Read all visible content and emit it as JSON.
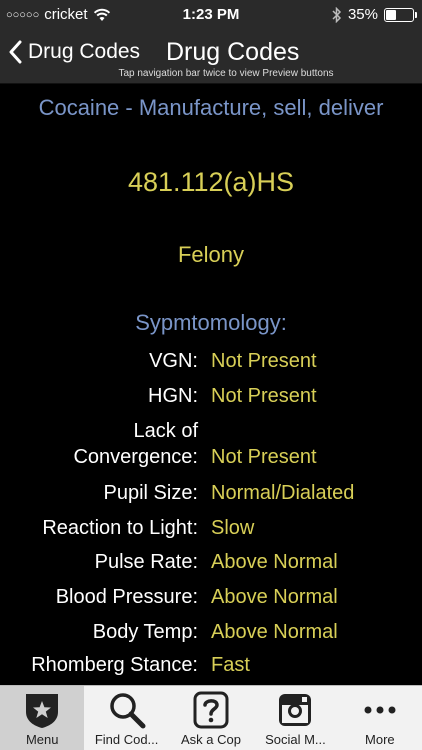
{
  "status_bar": {
    "carrier": "cricket",
    "signal_dots": "○○○○○",
    "time": "1:23 PM",
    "battery_percent": "35%",
    "battery_level": 0.35
  },
  "nav": {
    "back_label": "Drug Codes",
    "title": "Drug Codes",
    "hint": "Tap navigation bar twice to view Preview buttons"
  },
  "drug": {
    "name": "Cocaine - Manufacture, sell, deliver",
    "code": "481.112(a)HS",
    "classification": "Felony"
  },
  "symptomology": {
    "title": "Sypmtomology:",
    "rows": [
      {
        "label": "VGN:",
        "value": "Not Present"
      },
      {
        "label": "HGN:",
        "value": "Not Present"
      },
      {
        "label_line1": "Lack of",
        "label_line2": "Convergence:",
        "value": "Not Present"
      },
      {
        "label": "Pupil Size:",
        "value": "Normal/Dialated"
      },
      {
        "label": "Reaction to Light:",
        "value": "Slow"
      },
      {
        "label": "Pulse Rate:",
        "value": "Above Normal"
      },
      {
        "label": "Blood Pressure:",
        "value": "Above Normal"
      },
      {
        "label": "Body Temp:",
        "value": "Above Normal"
      },
      {
        "label": "Rhomberg Stance:",
        "value": "Fast"
      }
    ]
  },
  "tabs": [
    {
      "label": "Menu",
      "icon": "badge-star-icon"
    },
    {
      "label": "Find Cod...",
      "icon": "search-icon"
    },
    {
      "label": "Ask a Cop",
      "icon": "question-icon"
    },
    {
      "label": "Social M...",
      "icon": "instagram-icon"
    },
    {
      "label": "More",
      "icon": "more-icon"
    }
  ],
  "colors": {
    "accent_blue": "#7a95c8",
    "value_yellow": "#d8cf57",
    "bar_gray": "#2a2a2a"
  }
}
